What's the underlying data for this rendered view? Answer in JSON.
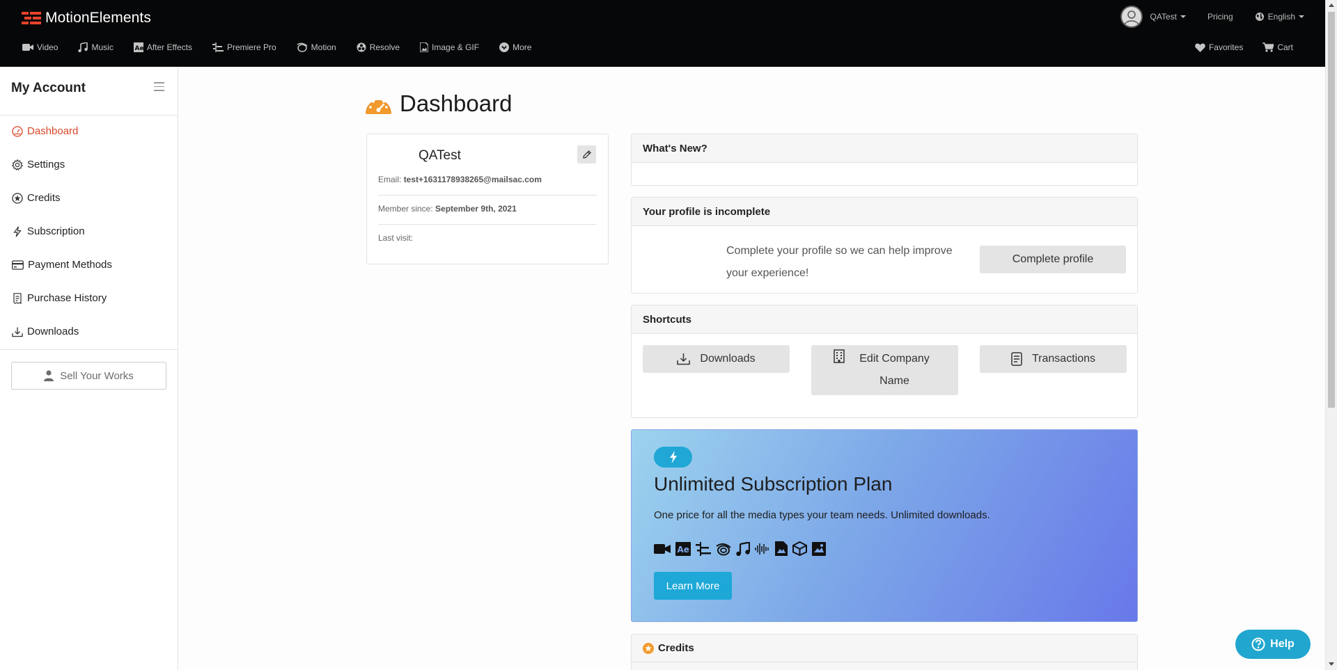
{
  "brand": {
    "name": "MotionElements"
  },
  "topbar": {
    "user": "QATest",
    "pricing": "Pricing",
    "language": "English"
  },
  "categories": [
    {
      "label": "Video",
      "icon": "video-camera-icon"
    },
    {
      "label": "Music",
      "icon": "music-note-icon"
    },
    {
      "label": "After Effects",
      "icon": "after-effects-icon"
    },
    {
      "label": "Premiere Pro",
      "icon": "premiere-pro-icon"
    },
    {
      "label": "Motion",
      "icon": "motion-icon"
    },
    {
      "label": "Resolve",
      "icon": "resolve-icon"
    },
    {
      "label": "Image & GIF",
      "icon": "image-file-icon"
    },
    {
      "label": "More",
      "icon": "chevron-circle-down-icon"
    }
  ],
  "nav_right": {
    "favorites": "Favorites",
    "cart": "Cart"
  },
  "sidebar": {
    "title": "My Account",
    "items": [
      {
        "label": "Dashboard",
        "icon": "dashboard-icon",
        "active": true
      },
      {
        "label": "Settings",
        "icon": "gear-icon"
      },
      {
        "label": "Credits",
        "icon": "star-circle-icon"
      },
      {
        "label": "Subscription",
        "icon": "lightning-icon"
      },
      {
        "label": "Payment Methods",
        "icon": "credit-card-icon"
      },
      {
        "label": "Purchase History",
        "icon": "receipt-icon"
      },
      {
        "label": "Downloads",
        "icon": "download-icon"
      }
    ],
    "sell_button": "Sell Your Works"
  },
  "main": {
    "title": "Dashboard",
    "profile": {
      "name": "QATest",
      "email_label": "Email:",
      "email": "test+1631178938265@mailsac.com",
      "member_label": "Member since:",
      "member_since": "September 9th, 2021",
      "last_visit_label": "Last visit:"
    },
    "whats_new": {
      "title": "What's New?"
    },
    "incomplete": {
      "title": "Your profile is incomplete",
      "text": "Complete your profile so we can help improve your experience!",
      "button": "Complete profile"
    },
    "shortcuts": {
      "title": "Shortcuts",
      "downloads": "Downloads",
      "edit_company": "Edit Company Name",
      "transactions": "Transactions"
    },
    "promo": {
      "title": "Unlimited Subscription Plan",
      "description": "One price for all the media types your team needs. Unlimited downloads.",
      "button": "Learn More"
    },
    "credits": {
      "title": "Credits"
    }
  },
  "help": {
    "label": "Help"
  },
  "colors": {
    "accent": "#d9482b",
    "promo_button": "#1da8d8",
    "topbar": "#060708"
  }
}
